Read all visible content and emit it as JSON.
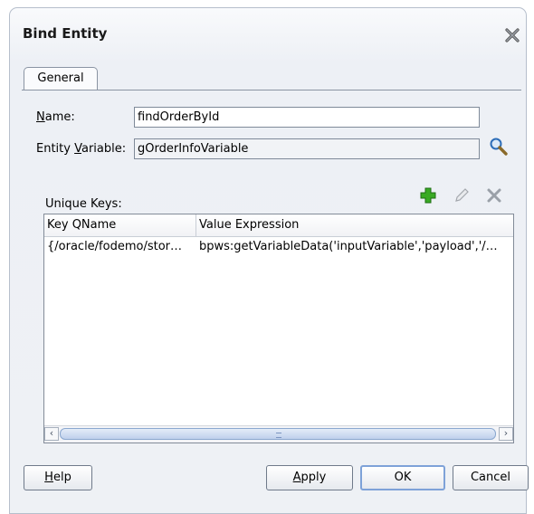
{
  "dialog": {
    "title": "Bind Entity",
    "tabs": [
      {
        "label": "General",
        "active": true
      }
    ],
    "name": {
      "label_mnemonic": "N",
      "label_rest": "ame:",
      "value": "findOrderById"
    },
    "entity_variable": {
      "label_pre": "Entity ",
      "label_mnemonic": "V",
      "label_rest": "ariable:",
      "value": "gOrderInfoVariable"
    },
    "unique_keys": {
      "label": "Unique Keys:",
      "columns": [
        "Key QName",
        "Value Expression"
      ],
      "rows": [
        {
          "key_qname": "{/oracle/fodemo/stor…",
          "value_expression": "bpws:getVariableData('inputVariable','payload','/…"
        }
      ]
    },
    "buttons": {
      "help_mnemonic": "H",
      "help_rest": "elp",
      "apply_mnemonic": "A",
      "apply_rest": "pply",
      "ok": "OK",
      "cancel": "Cancel"
    }
  },
  "icons": {
    "close": "close-x-icon",
    "search": "search-magnifier-icon",
    "add": "add-plus-icon",
    "edit": "edit-pencil-icon",
    "delete": "delete-x-icon"
  },
  "colors": {
    "add_icon": "#2f9a1e",
    "search_icon": "#2c6db8",
    "title_bar": "#edf0f5"
  }
}
